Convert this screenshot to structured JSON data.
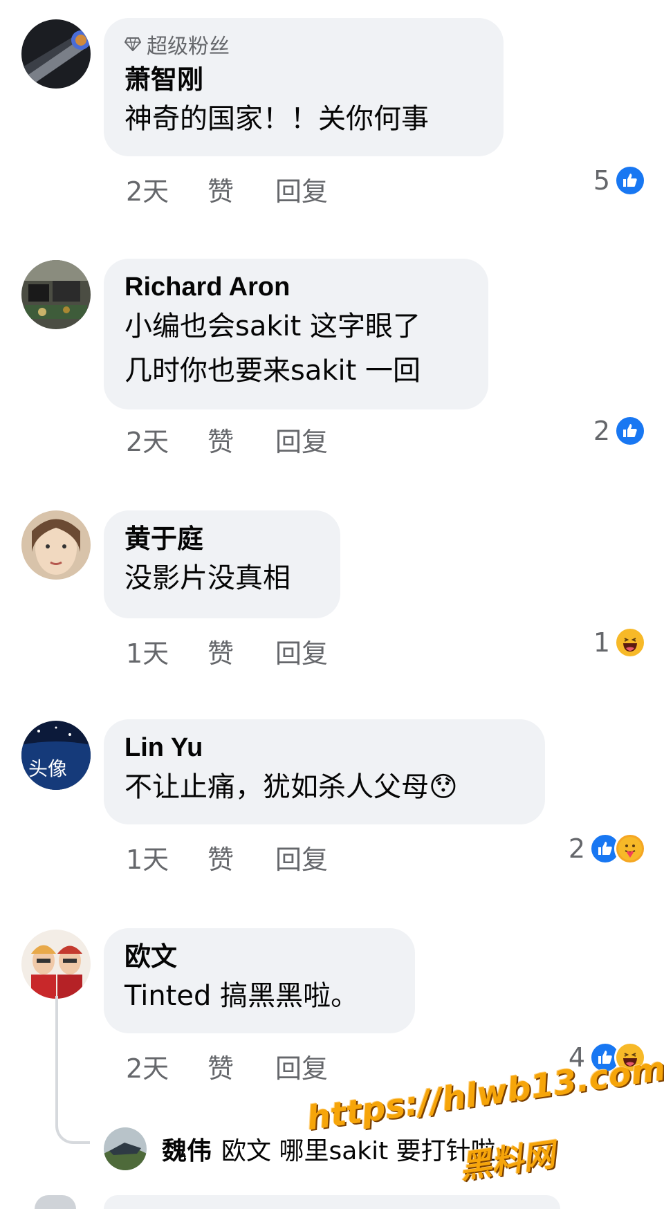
{
  "comments": [
    {
      "badge": "超级粉丝",
      "name": "萧智刚",
      "lines": [
        "神奇的国家！！关你何事"
      ],
      "time": "2天",
      "like": "赞",
      "reply": "回复",
      "react_count": "5",
      "reactions": [
        "like-icon"
      ]
    },
    {
      "name": "Richard Aron",
      "lines": [
        "小编也会sakit 这字眼了",
        "几时你也要来sakit 一回"
      ],
      "time": "2天",
      "like": "赞",
      "reply": "回复",
      "react_count": "2",
      "reactions": [
        "like-icon"
      ]
    },
    {
      "name": "黄于庭",
      "lines": [
        "没影片没真相"
      ],
      "time": "1天",
      "like": "赞",
      "reply": "回复",
      "react_count": "1",
      "reactions": [
        "haha-icon"
      ]
    },
    {
      "name": "Lin Yu",
      "lines": [
        "不让止痛，犹如杀人父母😯"
      ],
      "avatar_text": "头像",
      "time": "1天",
      "like": "赞",
      "reply": "回复",
      "react_count": "2",
      "reactions": [
        "like-icon",
        "care-icon"
      ]
    },
    {
      "name": "欧文",
      "lines": [
        "Tinted 搞黑黑啦。"
      ],
      "time": "2天",
      "like": "赞",
      "reply": "回复",
      "react_count": "4",
      "reactions": [
        "like-icon",
        "haha-icon"
      ]
    }
  ],
  "reply": {
    "name": "魏伟",
    "text": "欧文 哪里sakit 要打针啦。"
  },
  "watermark": {
    "url": "https://hlwb13.com",
    "label": "黑料网"
  },
  "colors": {
    "bubble": "#f0f2f5",
    "meta": "#65676b",
    "like": "#1877f2",
    "haha": "#f7b928",
    "watermark": "#f6a50a"
  }
}
